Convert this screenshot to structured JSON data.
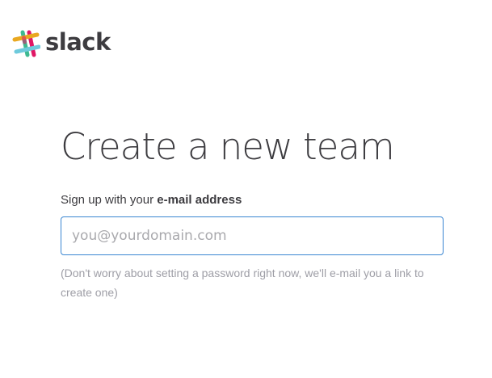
{
  "header": {
    "logo_text": "slack",
    "logo_colors": [
      "#e01765",
      "#3eb991",
      "#e9a820",
      "#6ecadc"
    ]
  },
  "main": {
    "title": "Create a new team",
    "signup_prefix": "Sign up with your ",
    "signup_bold": "e-mail address",
    "email_value": "",
    "email_placeholder": "you@yourdomain.com",
    "hint": "(Don't worry about setting a password right now, we'll e-mail you a link to create one)"
  }
}
